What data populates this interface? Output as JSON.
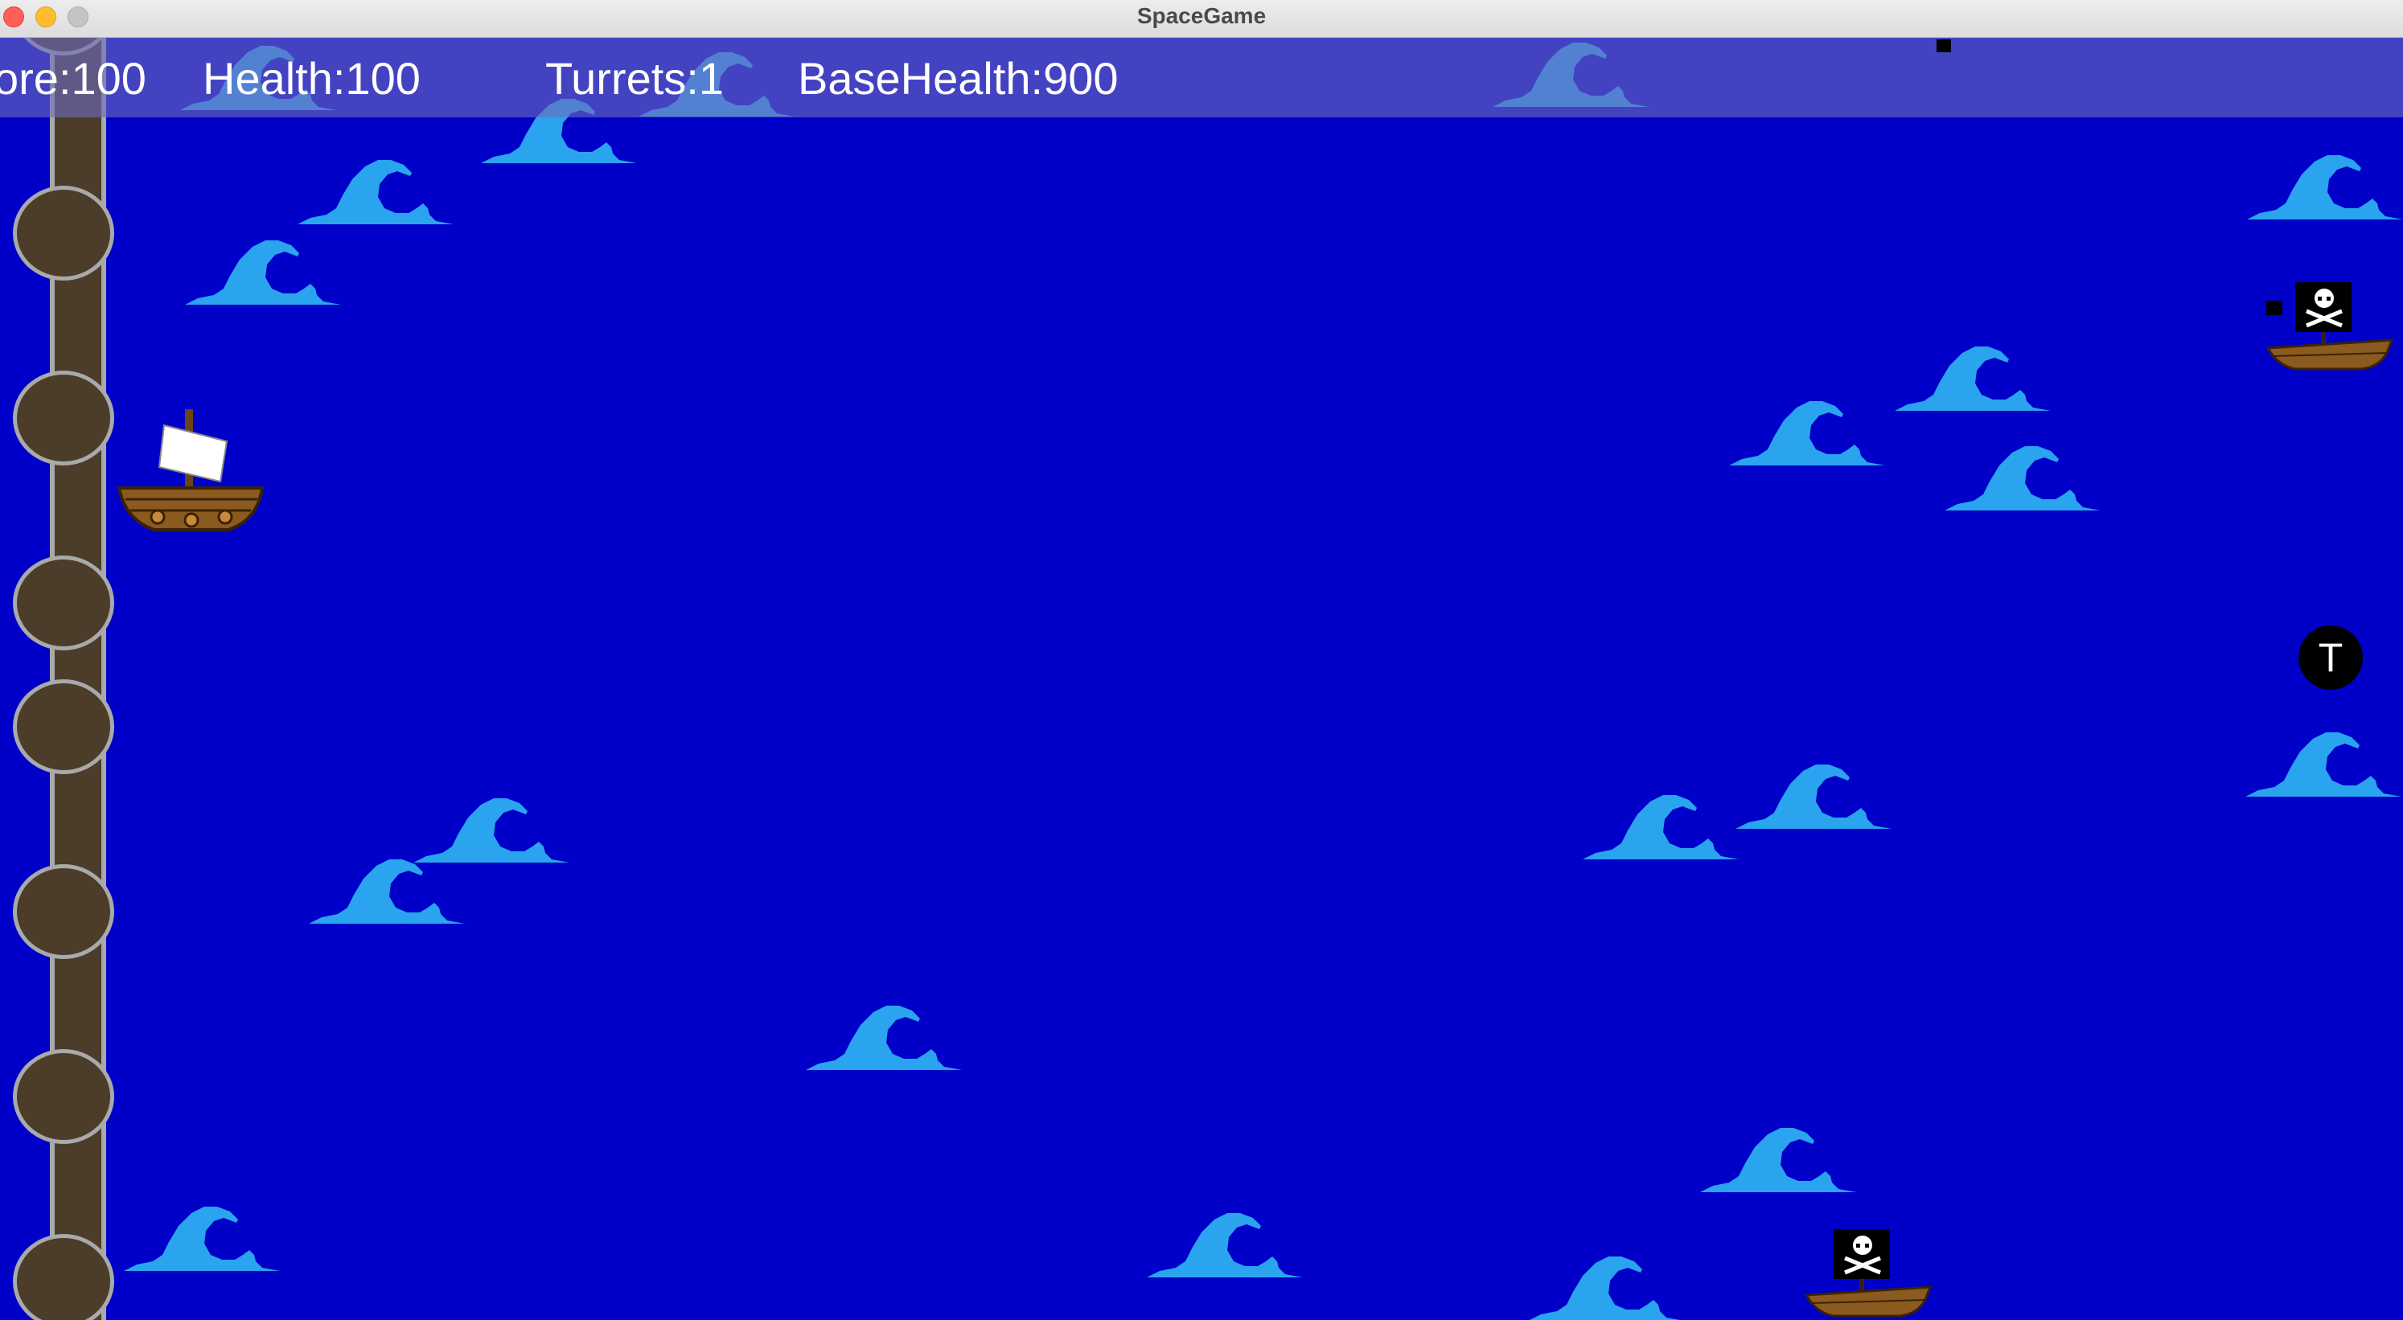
{
  "window": {
    "title": "SpaceGame"
  },
  "hud": {
    "score": "ore:100",
    "health": "Health:100",
    "turrets": "Turrets:1",
    "base_health": "BaseHealth:900"
  },
  "controls": {
    "turret_button": "T"
  },
  "colors": {
    "sea": "#0000c9",
    "wave": "#2aa4ef",
    "hud_bar": "#6c6cbe",
    "base_wood": "#4c3c2a",
    "base_rim": "#a9a9a9"
  },
  "icons": {
    "player": "player-ship-icon",
    "enemy": "pirate-ship-icon",
    "wave": "wave-icon",
    "base_node": "base-node-icon"
  }
}
